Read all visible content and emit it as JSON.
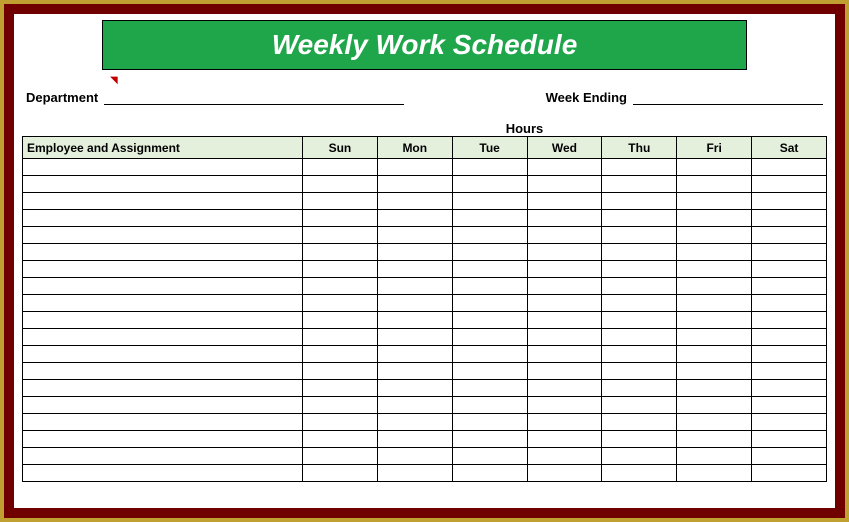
{
  "title": "Weekly Work Schedule",
  "meta": {
    "department_label": "Department",
    "department_value": "",
    "week_ending_label": "Week Ending",
    "week_ending_value": ""
  },
  "hours_label": "Hours",
  "columns": {
    "employee": "Employee and Assignment",
    "days": [
      "Sun",
      "Mon",
      "Tue",
      "Wed",
      "Thu",
      "Fri",
      "Sat"
    ]
  },
  "rows": [
    {
      "employee": "",
      "sun": "",
      "mon": "",
      "tue": "",
      "wed": "",
      "thu": "",
      "fri": "",
      "sat": ""
    },
    {
      "employee": "",
      "sun": "",
      "mon": "",
      "tue": "",
      "wed": "",
      "thu": "",
      "fri": "",
      "sat": ""
    },
    {
      "employee": "",
      "sun": "",
      "mon": "",
      "tue": "",
      "wed": "",
      "thu": "",
      "fri": "",
      "sat": ""
    },
    {
      "employee": "",
      "sun": "",
      "mon": "",
      "tue": "",
      "wed": "",
      "thu": "",
      "fri": "",
      "sat": ""
    },
    {
      "employee": "",
      "sun": "",
      "mon": "",
      "tue": "",
      "wed": "",
      "thu": "",
      "fri": "",
      "sat": ""
    },
    {
      "employee": "",
      "sun": "",
      "mon": "",
      "tue": "",
      "wed": "",
      "thu": "",
      "fri": "",
      "sat": ""
    },
    {
      "employee": "",
      "sun": "",
      "mon": "",
      "tue": "",
      "wed": "",
      "thu": "",
      "fri": "",
      "sat": ""
    },
    {
      "employee": "",
      "sun": "",
      "mon": "",
      "tue": "",
      "wed": "",
      "thu": "",
      "fri": "",
      "sat": ""
    },
    {
      "employee": "",
      "sun": "",
      "mon": "",
      "tue": "",
      "wed": "",
      "thu": "",
      "fri": "",
      "sat": ""
    },
    {
      "employee": "",
      "sun": "",
      "mon": "",
      "tue": "",
      "wed": "",
      "thu": "",
      "fri": "",
      "sat": ""
    },
    {
      "employee": "",
      "sun": "",
      "mon": "",
      "tue": "",
      "wed": "",
      "thu": "",
      "fri": "",
      "sat": ""
    },
    {
      "employee": "",
      "sun": "",
      "mon": "",
      "tue": "",
      "wed": "",
      "thu": "",
      "fri": "",
      "sat": ""
    },
    {
      "employee": "",
      "sun": "",
      "mon": "",
      "tue": "",
      "wed": "",
      "thu": "",
      "fri": "",
      "sat": ""
    },
    {
      "employee": "",
      "sun": "",
      "mon": "",
      "tue": "",
      "wed": "",
      "thu": "",
      "fri": "",
      "sat": ""
    },
    {
      "employee": "",
      "sun": "",
      "mon": "",
      "tue": "",
      "wed": "",
      "thu": "",
      "fri": "",
      "sat": ""
    },
    {
      "employee": "",
      "sun": "",
      "mon": "",
      "tue": "",
      "wed": "",
      "thu": "",
      "fri": "",
      "sat": ""
    },
    {
      "employee": "",
      "sun": "",
      "mon": "",
      "tue": "",
      "wed": "",
      "thu": "",
      "fri": "",
      "sat": ""
    },
    {
      "employee": "",
      "sun": "",
      "mon": "",
      "tue": "",
      "wed": "",
      "thu": "",
      "fri": "",
      "sat": ""
    },
    {
      "employee": "",
      "sun": "",
      "mon": "",
      "tue": "",
      "wed": "",
      "thu": "",
      "fri": "",
      "sat": ""
    }
  ]
}
